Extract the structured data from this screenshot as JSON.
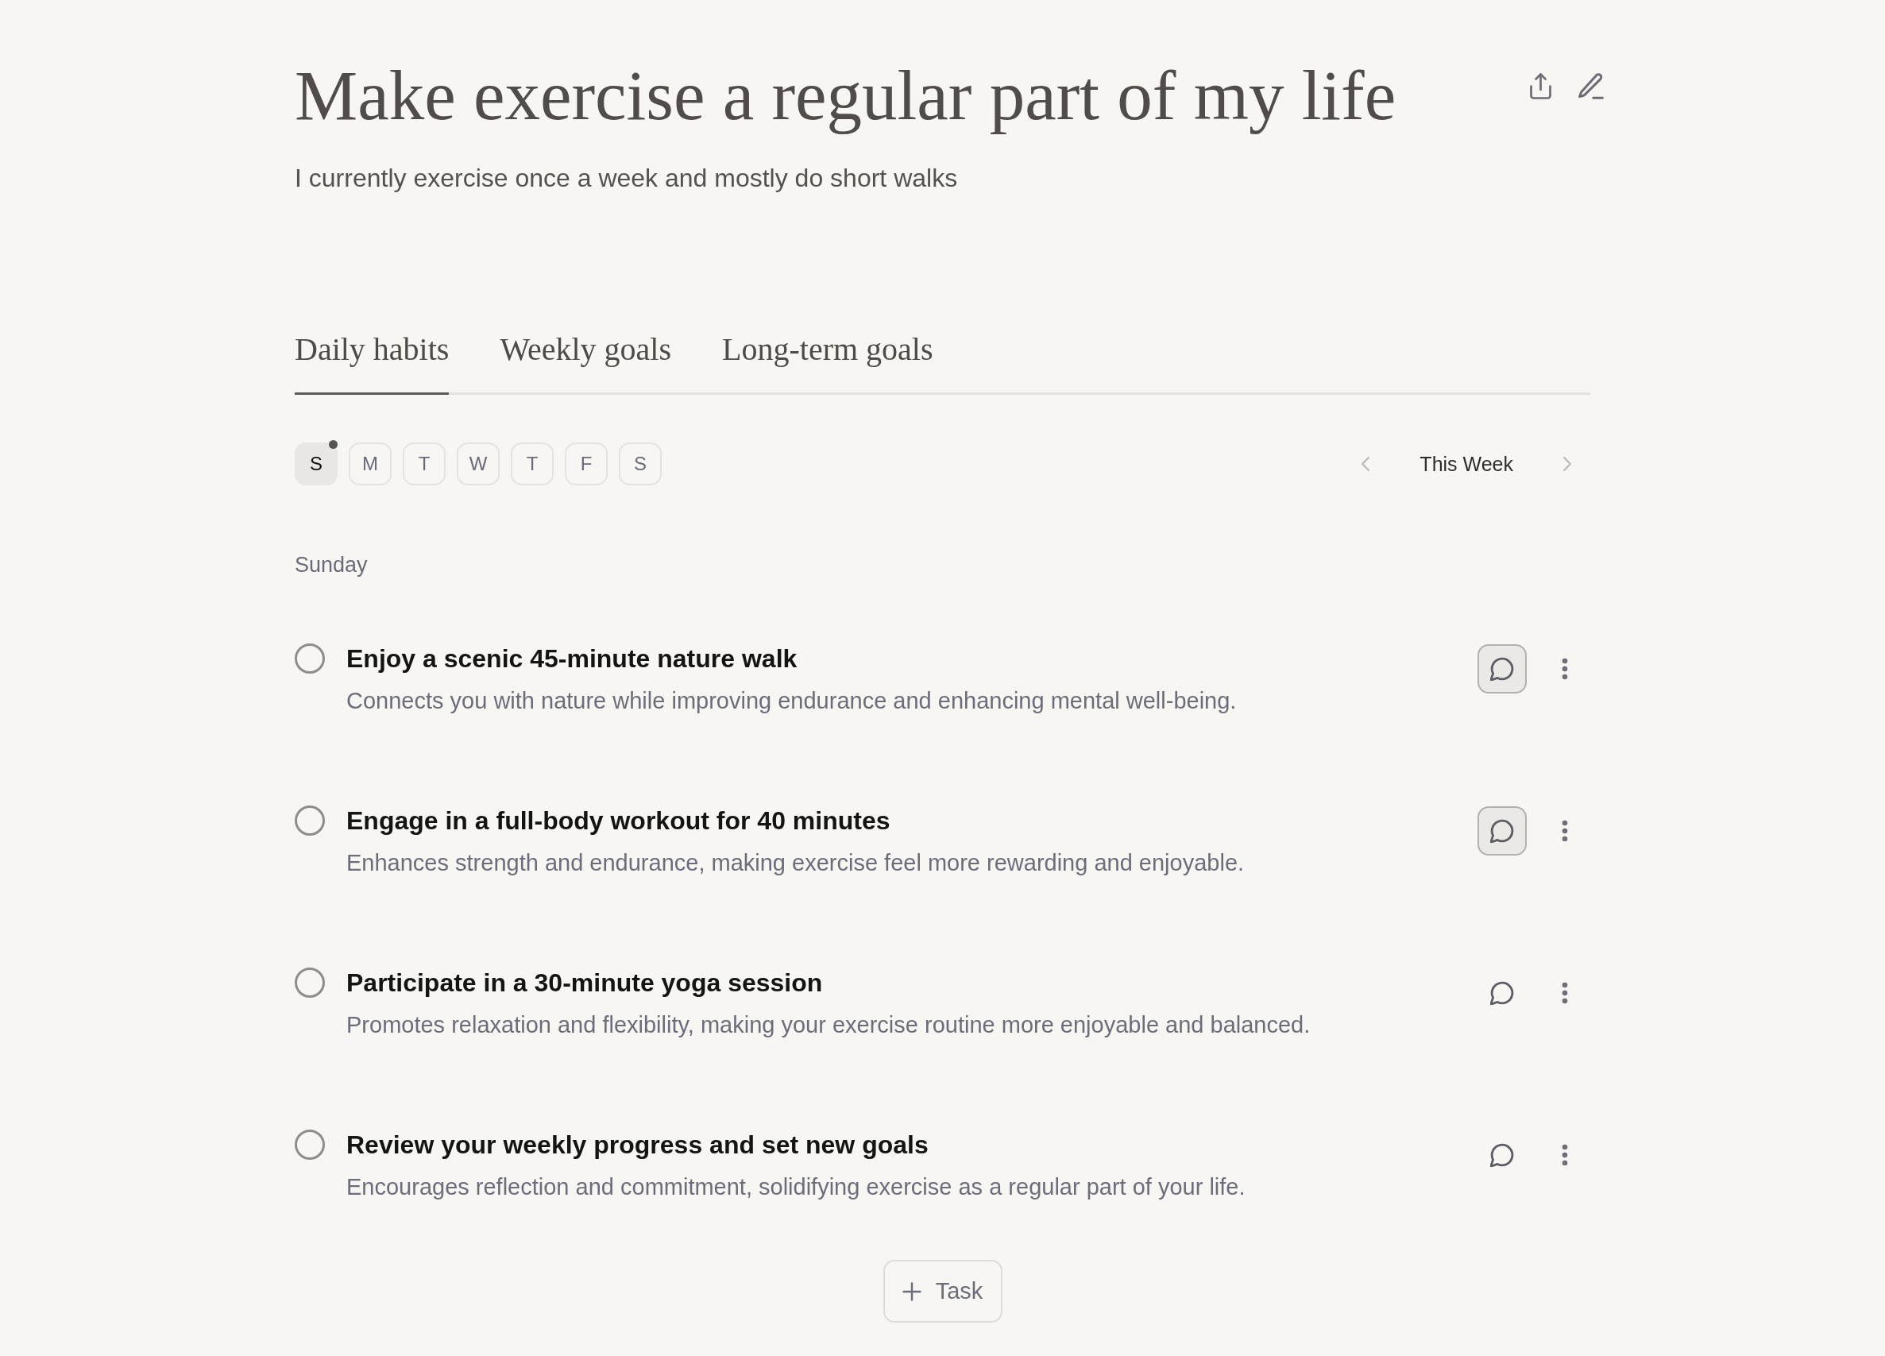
{
  "header": {
    "title": "Make exercise a regular part of my life",
    "subtitle": "I currently exercise once a week and mostly do short walks"
  },
  "tabs": [
    {
      "label": "Daily habits",
      "selected": true
    },
    {
      "label": "Weekly goals",
      "selected": false
    },
    {
      "label": "Long-term goals",
      "selected": false
    }
  ],
  "days": [
    {
      "label": "S",
      "selected": true,
      "indicator": true
    },
    {
      "label": "M",
      "selected": false,
      "indicator": false
    },
    {
      "label": "T",
      "selected": false,
      "indicator": false
    },
    {
      "label": "W",
      "selected": false,
      "indicator": false
    },
    {
      "label": "T",
      "selected": false,
      "indicator": false
    },
    {
      "label": "F",
      "selected": false,
      "indicator": false
    },
    {
      "label": "S",
      "selected": false,
      "indicator": false
    }
  ],
  "week_nav": {
    "label": "This Week"
  },
  "day_heading": "Sunday",
  "tasks": [
    {
      "title": "Enjoy a scenic 45-minute nature walk",
      "description": "Connects you with nature while improving endurance and enhancing mental well-being.",
      "checked": false,
      "comment_active": true
    },
    {
      "title": "Engage in a full-body workout for 40 minutes",
      "description": "Enhances strength and endurance, making exercise feel more rewarding and enjoyable.",
      "checked": false,
      "comment_active": true
    },
    {
      "title": "Participate in a 30-minute yoga session",
      "description": "Promotes relaxation and flexibility, making your exercise routine more enjoyable and balanced.",
      "checked": false,
      "comment_active": false
    },
    {
      "title": "Review your weekly progress and set new goals",
      "description": "Encourages reflection and commitment, solidifying exercise as a regular part of your life.",
      "checked": false,
      "comment_active": false
    }
  ],
  "add_button": {
    "label": "Task"
  }
}
